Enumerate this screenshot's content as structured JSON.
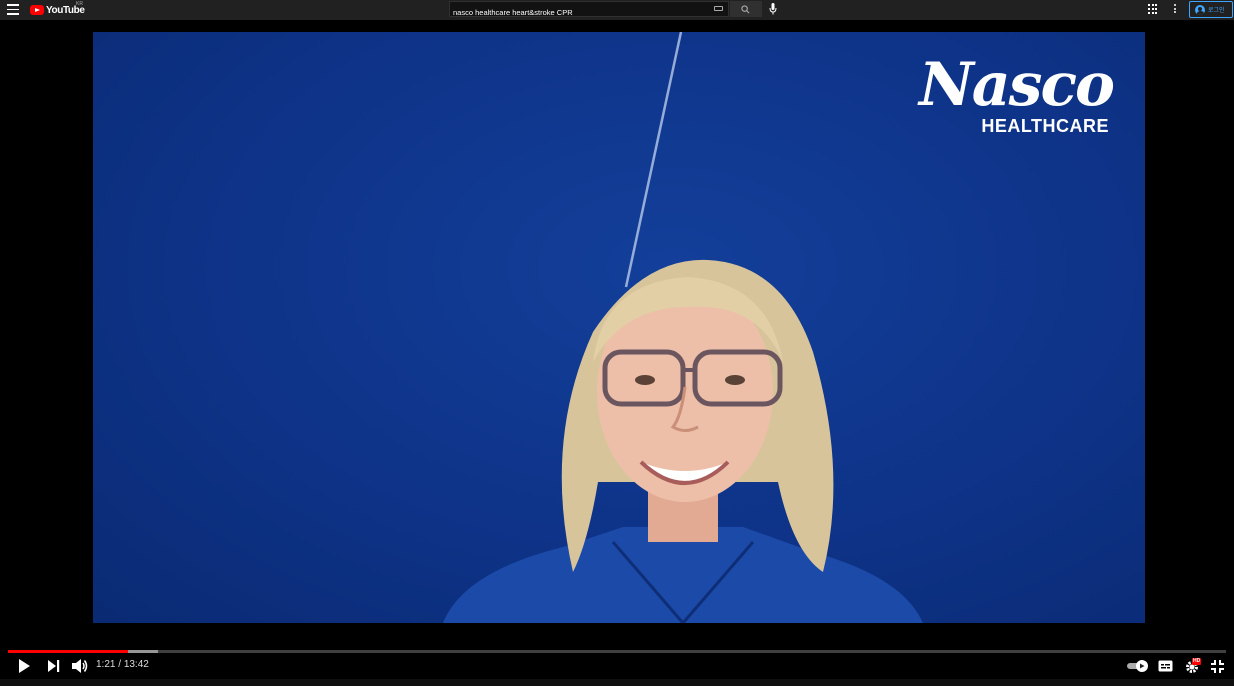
{
  "header": {
    "logo_text": "YouTube",
    "logo_region": "KR",
    "search_value": "nasco healthcare heart&stroke CPR",
    "login_label": "로그인"
  },
  "video": {
    "brand_script": "Nasco",
    "brand_sub": "HEALTHCARE"
  },
  "player": {
    "time_current": "1:21",
    "time_separator": "/",
    "time_total": "13:42",
    "progress_fraction": 0.0985,
    "buffer_fraction": 0.123,
    "accent_color": "#ff0000",
    "hd_badge": "HD"
  }
}
